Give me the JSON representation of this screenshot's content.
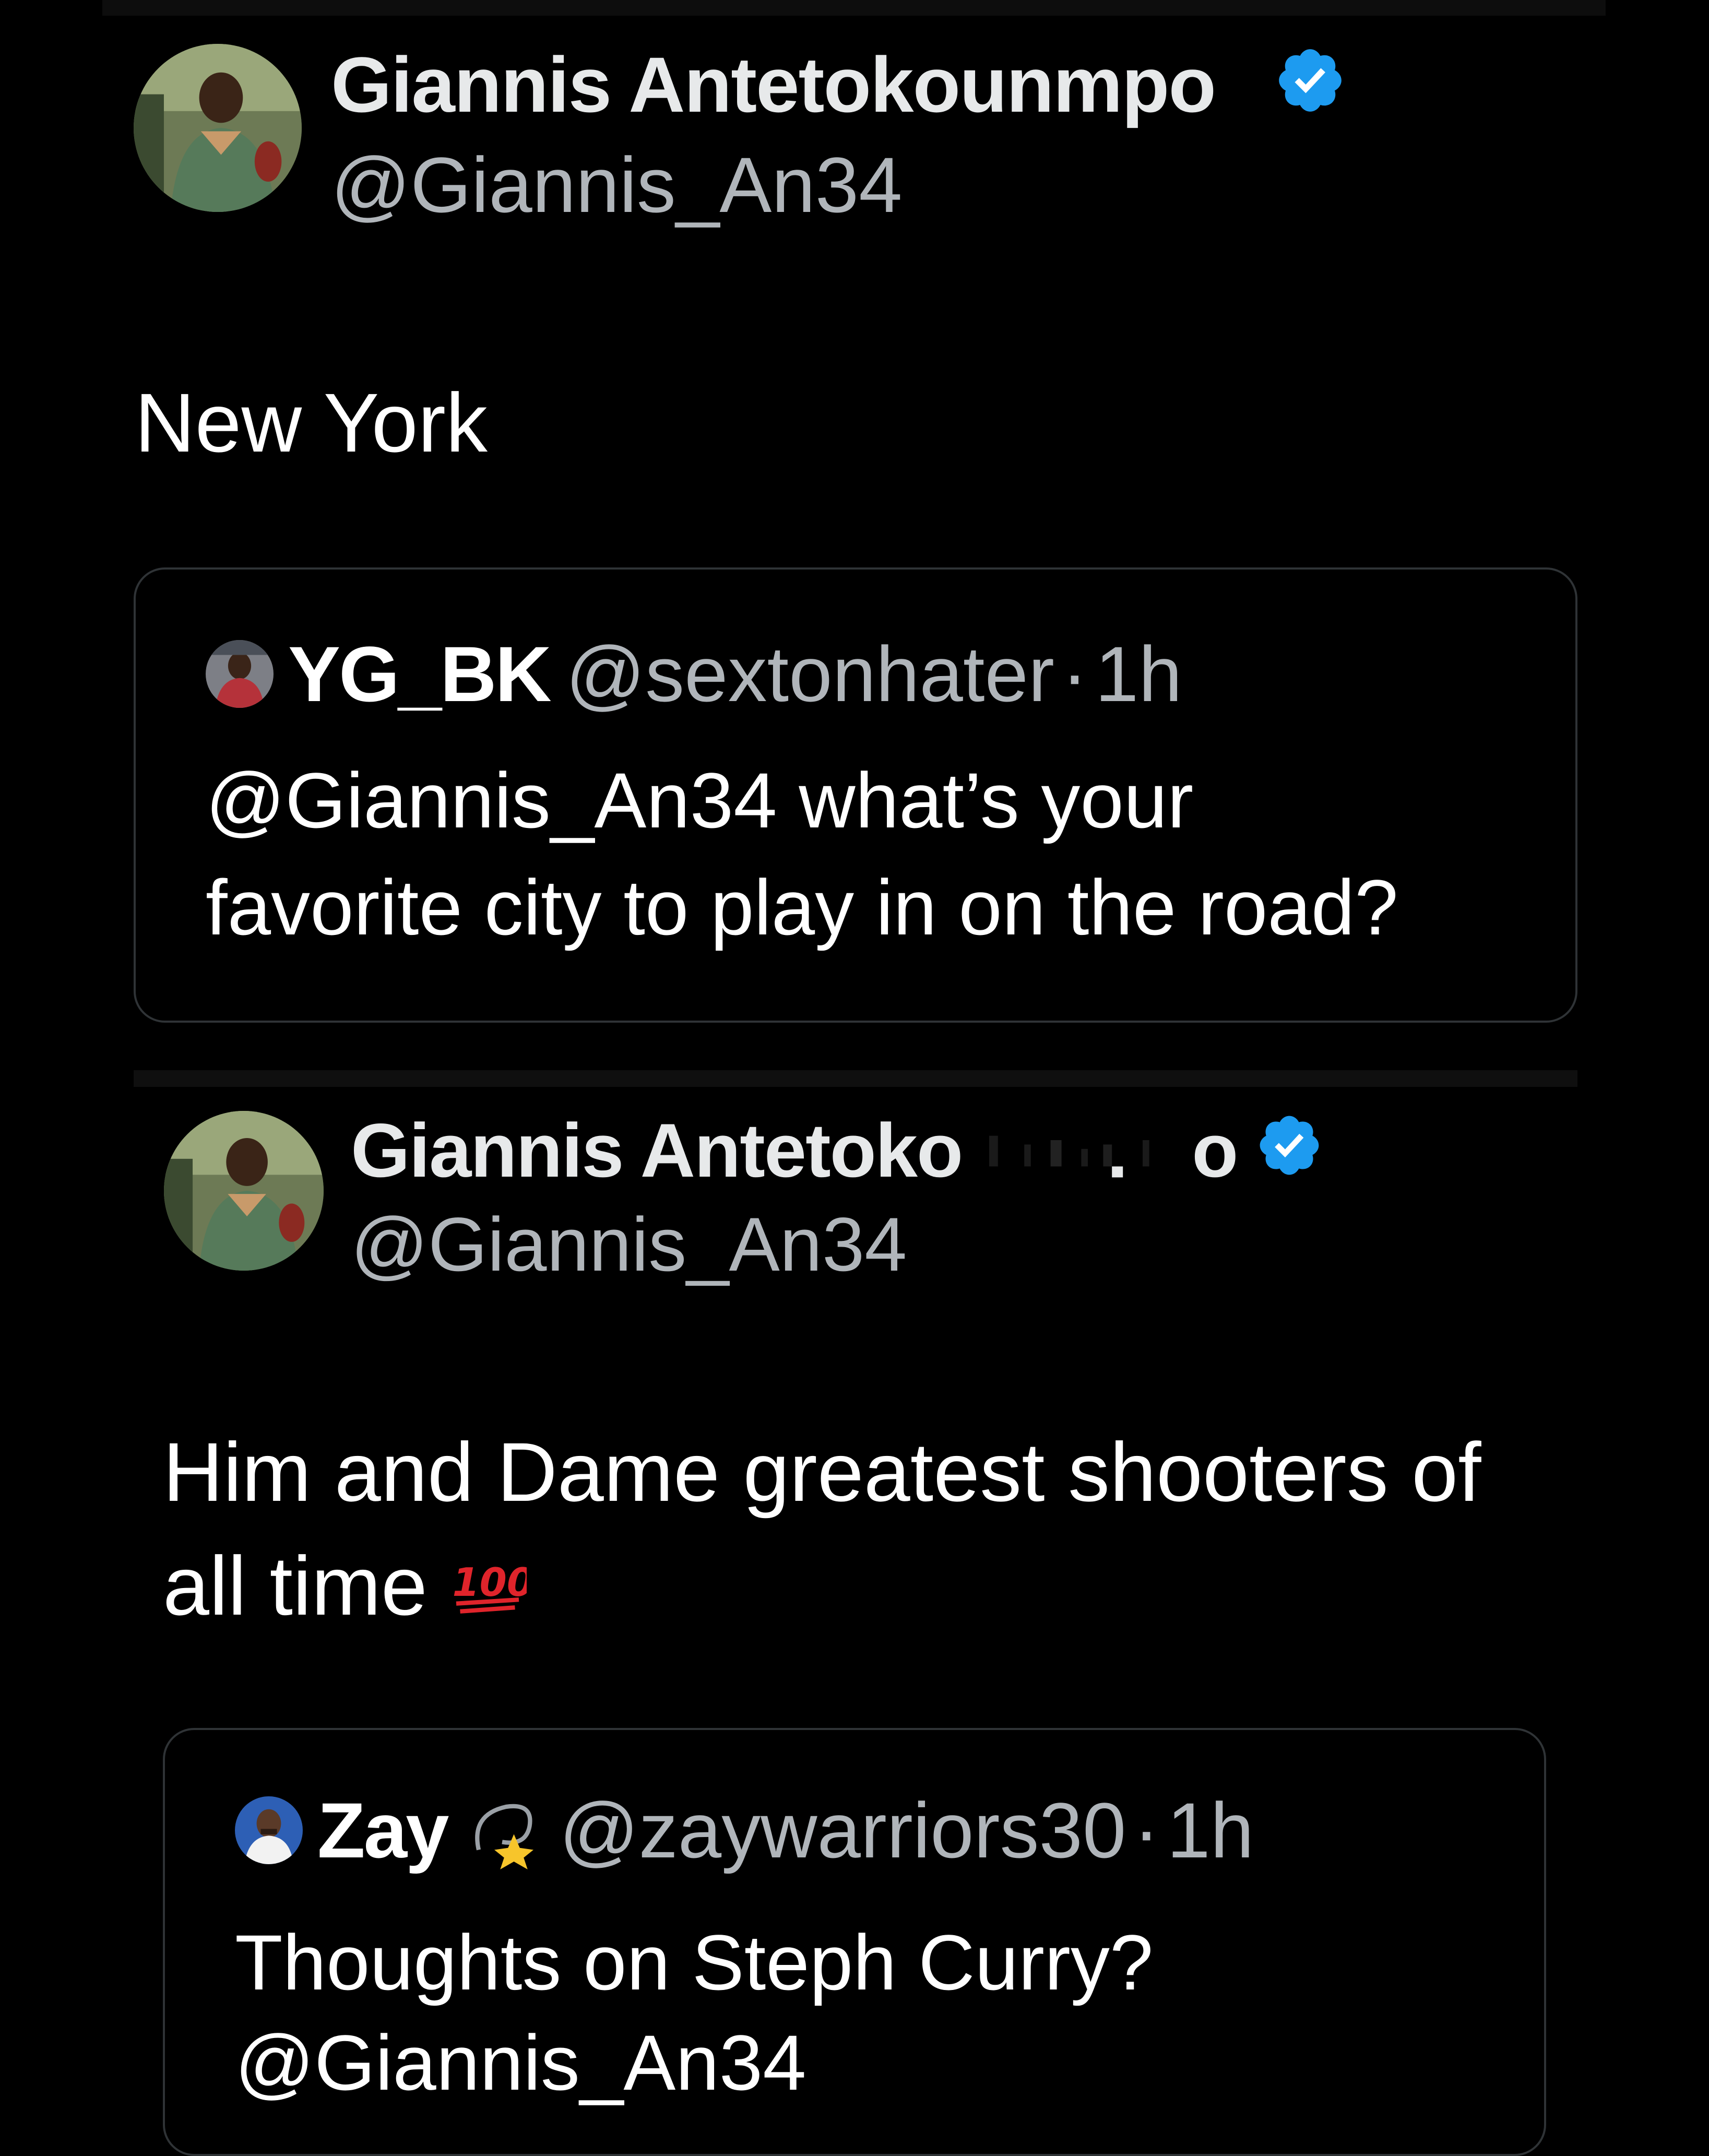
{
  "tweet1": {
    "author_name": "Giannis Antetokounmpo",
    "author_handle": "@Giannis_An34",
    "text": "New York",
    "quote": {
      "author_name": "YG_BK",
      "author_handle": "@sextonhater",
      "separator": "·",
      "time": "1h",
      "text_line1": "@Giannis_An34 what’s your",
      "text_line2": "favorite city to play in on the road?"
    }
  },
  "tweet2": {
    "author_name_start": "Giannis Antetoko",
    "author_name_end": "o",
    "author_handle": "@Giannis_An34",
    "text_line1": "Him and Dame greatest shooters of",
    "text_line2": "all time",
    "emoji": "💯",
    "quote": {
      "author_name": "Zay",
      "author_emoji": "💫",
      "author_handle": "@zaywarriors30",
      "separator": "·",
      "time": "1h",
      "text_line1": "Thoughts on Steph Curry?",
      "text_line2": "@Giannis_An34"
    }
  },
  "icons": {
    "verified": "verified-badge-icon",
    "hundred": "hundred-points-emoji",
    "dizzy": "dizzy-star-emoji"
  },
  "colors": {
    "background": "#000000",
    "verified_blue": "#1d9bf0",
    "muted_text": "#b0b5ba",
    "card_border": "#2f3336"
  }
}
